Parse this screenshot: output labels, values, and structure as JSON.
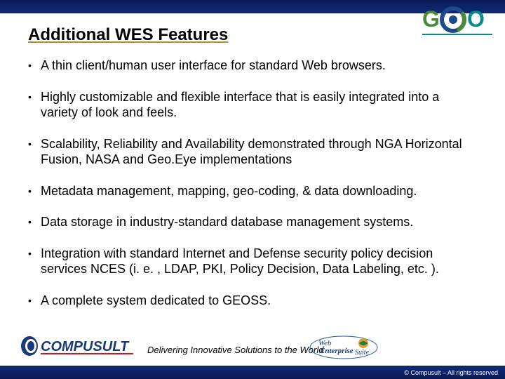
{
  "title": "Additional WES Features",
  "bullets": [
    "A thin client/human user interface for standard Web browsers.",
    "Highly customizable and flexible interface that is easily integrated into a variety of look and feels.",
    "Scalability, Reliability and Availability demonstrated through NGA Horizontal Fusion, NASA and Geo.Eye implementations",
    "Metadata management, mapping, geo-coding, & data downloading.",
    "Data storage in industry-standard database management systems.",
    "Integration with standard Internet and Defense security policy decision services NCES (i. e. , LDAP, PKI, Policy Decision, Data Labeling, etc. ).",
    "A complete system dedicated to GEOSS."
  ],
  "tagline": "Delivering Innovative Solutions to the World",
  "copyright": "© Compusult – All rights reserved",
  "logos": {
    "geo": "GEO",
    "compusult": "COMPUSULT",
    "wes": "Web Enterprise Suite"
  },
  "colors": {
    "geo_green": "#4a8a3a",
    "geo_blue": "#1a4a8a",
    "geo_teal": "#0a8a8a",
    "band": "#102a7a",
    "compusult_blue": "#1a3a7a"
  }
}
